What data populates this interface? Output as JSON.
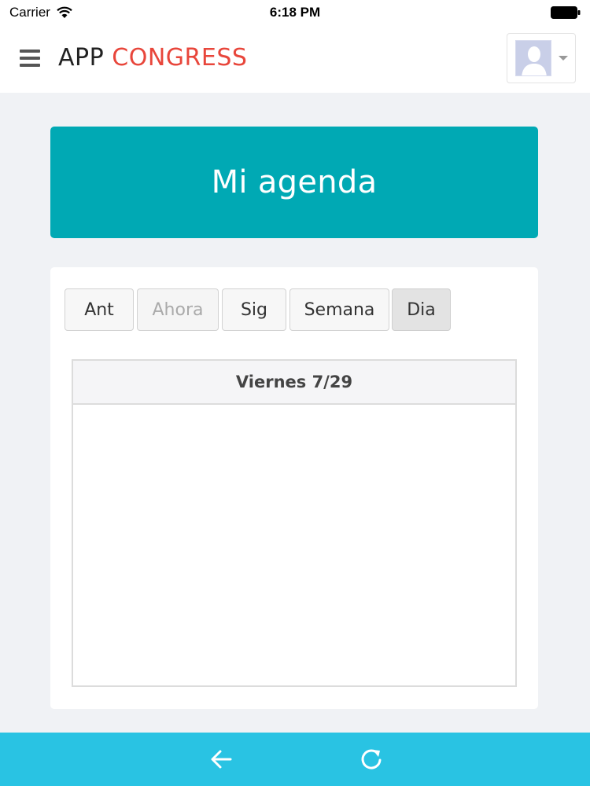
{
  "status_bar": {
    "carrier": "Carrier",
    "time": "6:18 PM"
  },
  "header": {
    "brand_app": "APP",
    "brand_congress": "CONGRESS",
    "menu_icon": "hamburger-menu-icon",
    "avatar_icon": "user-avatar-icon"
  },
  "page": {
    "title": "Mi agenda"
  },
  "toolbar": {
    "buttons": [
      {
        "label": "Ant"
      },
      {
        "label": "Ahora"
      },
      {
        "label": "Sig"
      },
      {
        "label": "Semana"
      },
      {
        "label": "Dia"
      }
    ]
  },
  "day_view": {
    "header": "Viernes 7/29"
  },
  "bottom_bar": {
    "back_icon": "back-arrow-icon",
    "reload_icon": "reload-icon"
  },
  "colors": {
    "brand_accent": "#e8463b",
    "banner": "#00a9b4",
    "bottom_bar": "#29c3e3",
    "background": "#f0f2f5"
  }
}
